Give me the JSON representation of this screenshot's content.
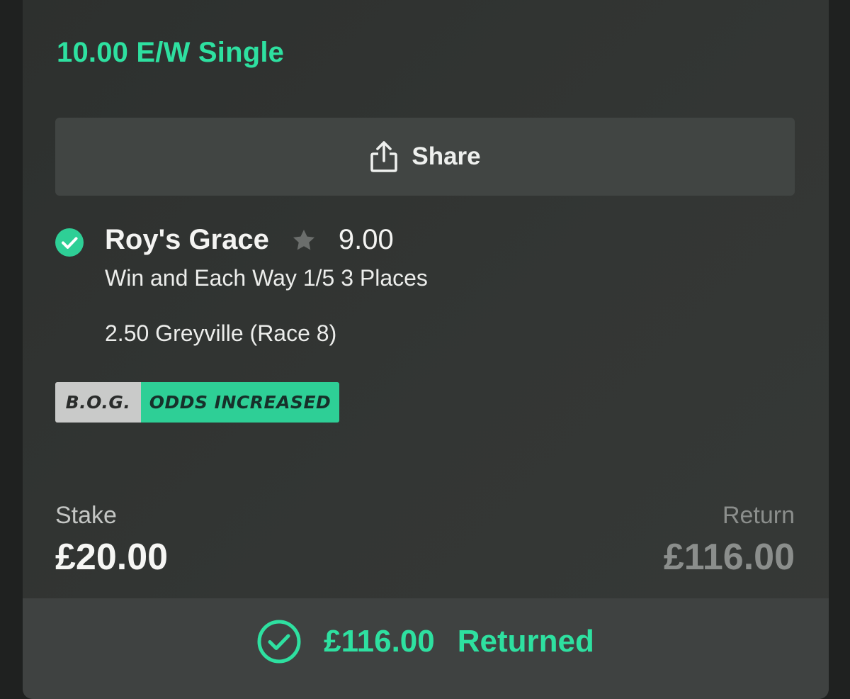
{
  "bet": {
    "title": "10.00 E/W Single"
  },
  "share": {
    "label": "Share",
    "icon": "share-icon"
  },
  "selection": {
    "status_icon": "check-circle-icon",
    "horse": "Roy's Grace",
    "favorite_icon": "star-icon",
    "odds": "9.00",
    "market": "Win and Each Way 1/5 3 Places",
    "event": "2.50 Greyville (Race 8)"
  },
  "badges": {
    "bog": "B.O.G.",
    "odds_increased": "ODDS INCREASED"
  },
  "summary": {
    "stake_label": "Stake",
    "stake_value": "£20.00",
    "return_label": "Return",
    "return_value": "£116.00"
  },
  "footer": {
    "icon": "check-circle-outline-icon",
    "amount": "£116.00",
    "status": "Returned"
  },
  "colors": {
    "accent": "#2ee0a0",
    "card_background": "#313432",
    "share_button": "#414543",
    "badge_bog": "#c9cac9",
    "badge_odds": "#2ecf96",
    "muted_text": "#8b8e8c"
  }
}
